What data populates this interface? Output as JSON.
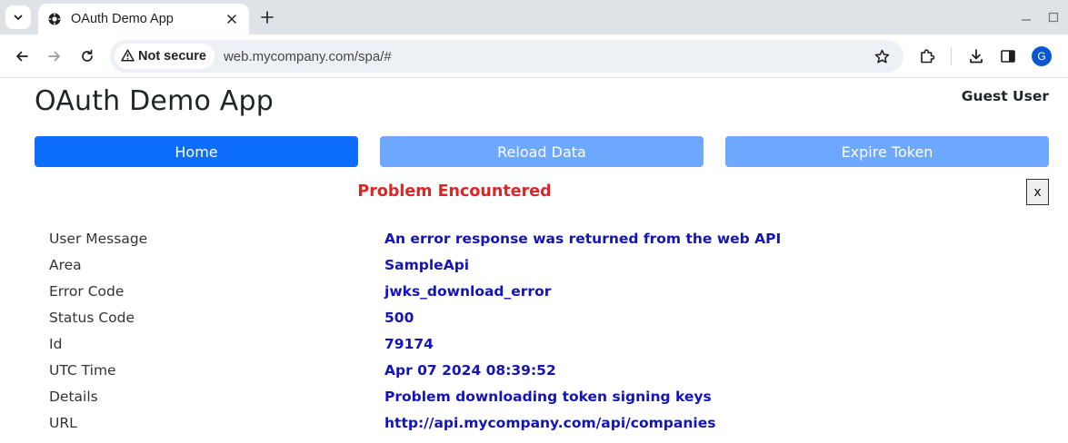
{
  "browser": {
    "tab_title": "OAuth Demo App",
    "security_label": "Not secure",
    "url": "web.mycompany.com/spa/#",
    "profile_initial": "G",
    "accent_color": "#0b57d0"
  },
  "icons": [
    "tab-search-icon",
    "oauth-favicon-icon",
    "close-icon",
    "plus-icon",
    "minimize-icon",
    "maximize-icon",
    "back-arrow-icon",
    "forward-arrow-icon",
    "reload-icon",
    "warning-icon",
    "star-icon",
    "extensions-icon",
    "download-icon",
    "side-panel-icon"
  ],
  "app": {
    "title": "OAuth Demo App",
    "user_name": "Guest User",
    "nav": {
      "home_label": "Home",
      "reload_label": "Reload Data",
      "expire_label": "Expire Token"
    },
    "colors": {
      "primary": "#0d6efd",
      "disabled_primary": "#6ea8fe",
      "error_heading": "#dc2626",
      "error_value": "#1414b8"
    }
  },
  "error": {
    "heading": "Problem Encountered",
    "close_label": "x",
    "rows": [
      {
        "label": "User Message",
        "value": "An error response was returned from the web API"
      },
      {
        "label": "Area",
        "value": "SampleApi"
      },
      {
        "label": "Error Code",
        "value": "jwks_download_error"
      },
      {
        "label": "Status Code",
        "value": "500"
      },
      {
        "label": "Id",
        "value": "79174"
      },
      {
        "label": "UTC Time",
        "value": "Apr 07 2024 08:39:52"
      },
      {
        "label": "Details",
        "value": "Problem downloading token signing keys"
      },
      {
        "label": "URL",
        "value": "http://api.mycompany.com/api/companies"
      }
    ]
  }
}
